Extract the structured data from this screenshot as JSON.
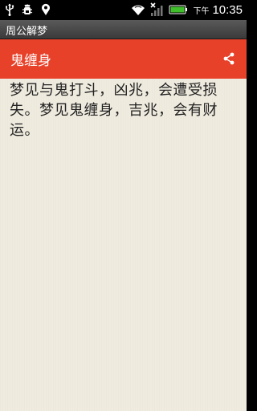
{
  "status_bar": {
    "ampm": "下午",
    "time": "10:35",
    "icons_left": [
      "usb-icon",
      "debug-icon",
      "location-icon"
    ],
    "icons_right": [
      "wifi-icon",
      "signal-icon",
      "battery-icon"
    ]
  },
  "app_title": "周公解梦",
  "action_bar": {
    "title": "鬼缠身",
    "share_icon": "share-icon",
    "color": "#e8412a"
  },
  "content": {
    "text": "梦见与鬼打斗，凶兆，会遭受损失。梦见鬼缠身，吉兆，会有财运。"
  }
}
